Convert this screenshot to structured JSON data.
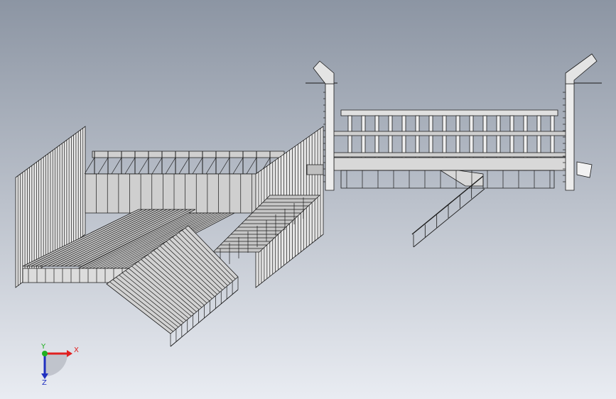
{
  "viewport": {
    "background_top": "#8c95a3",
    "background_bottom": "#e9ecf2",
    "model_line_color": "#1a1a1a",
    "model_face_color": "#d9d9d9"
  },
  "triad": {
    "x_label": "X",
    "y_label": "Y",
    "z_label": "Z",
    "x_color": "#e02020",
    "y_color": "#20b020",
    "z_color": "#2030c0"
  }
}
